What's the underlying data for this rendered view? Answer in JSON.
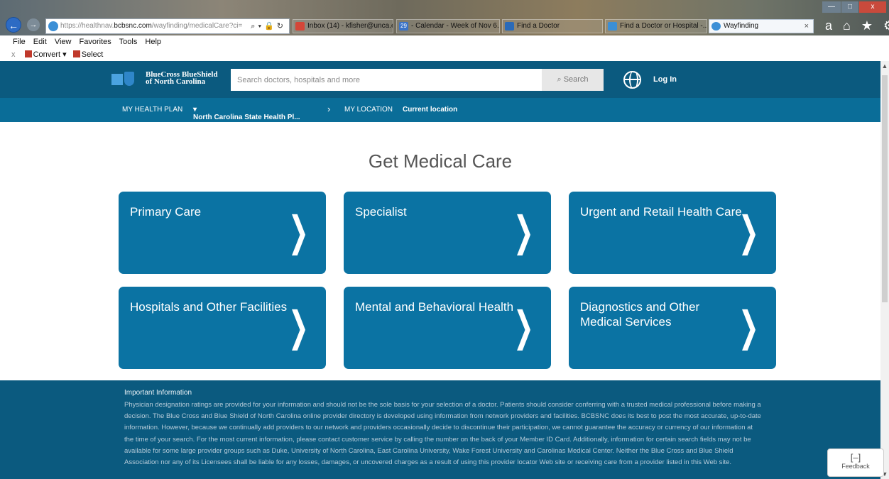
{
  "browser": {
    "address": {
      "prefix": "https://healthnav.",
      "domain": "bcbsnc.com",
      "path": "/wayfinding/medicalCare?ci="
    },
    "tabs": [
      {
        "label": "Inbox (14) - kfisher@unca.e..."
      },
      {
        "label": "29"
      },
      {
        "label": " - Calendar - Week of Nov 6..."
      },
      {
        "label": "Find a Doctor"
      },
      {
        "label": "Find a Doctor or Hospital -..."
      },
      {
        "label": "Wayfinding",
        "close": "×"
      }
    ],
    "window_controls": {
      "minimize": "—",
      "maximize": "□",
      "close": "x"
    },
    "toolbar_icons": "a ⌂ ★ ⚙",
    "menu": [
      "File",
      "Edit",
      "View",
      "Favorites",
      "Tools",
      "Help"
    ],
    "addon": {
      "close": "x",
      "convert": "Convert",
      "select": "Select"
    }
  },
  "header": {
    "logo_line1": "BlueCross BlueShield",
    "logo_line2": "of North Carolina",
    "search_placeholder": "Search doctors, hospitals and more",
    "search_button": "Search",
    "login": "Log In"
  },
  "subnav": {
    "plan_label": "MY HEALTH PLAN",
    "plan_value": "North Carolina State Health Pl...",
    "location_label": "MY LOCATION",
    "location_value": "Current location"
  },
  "main": {
    "title": "Get Medical Care",
    "cards": [
      {
        "label": "Primary Care"
      },
      {
        "label": "Specialist"
      },
      {
        "label": "Urgent and Retail Health Care"
      },
      {
        "label": "Hospitals and Other Facilities"
      },
      {
        "label": "Mental and Behavioral Health"
      },
      {
        "label": "Diagnostics and Other Medical Services"
      }
    ]
  },
  "footer": {
    "heading": "Important Information",
    "text": "Physician designation ratings are provided for your information and should not be the sole basis for your selection of a doctor. Patients should consider conferring with a trusted medical professional before making a decision. The Blue Cross and Blue Shield of North Carolina online provider directory is developed using information from network providers and facilities. BCBSNC does its best to post the most accurate, up-to-date information. However, because we continually add providers to our network and providers occasionally decide to discontinue their participation, we cannot guarantee the accuracy or currency of our information at the time of your search. For the most current information, please contact customer service by calling the number on the back of your Member ID Card. Additionally, information for certain search fields may not be available for some large provider groups such as Duke, University of North Carolina, East Carolina University, Wake Forest University and Carolinas Medical Center. Neither the Blue Cross and Blue Shield Association nor any of its Licensees shall be liable for any losses, damages, or uncovered charges as a result of using this provider locator Web site or receiving care from a provider listed in this Web site."
  },
  "feedback": {
    "icon": "[–]",
    "label": "Feedback"
  }
}
